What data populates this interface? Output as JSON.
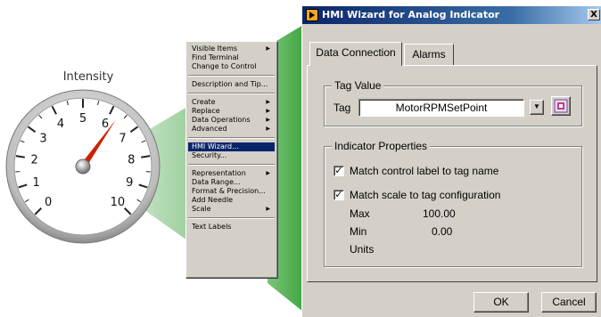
{
  "gauge": {
    "title": "Intensity",
    "ticks": [
      "0",
      "1",
      "2",
      "3",
      "4",
      "5",
      "6",
      "7",
      "8",
      "9",
      "10"
    ],
    "value": 6.3,
    "min": 0,
    "max": 10,
    "needle_color": "#cc2200"
  },
  "menu": {
    "items": [
      {
        "label": "Visible Items",
        "arrow": "▶"
      },
      {
        "label": "Find Terminal",
        "arrow": ""
      },
      {
        "label": "Change to Control",
        "arrow": ""
      },
      {
        "label": "Description and Tip...",
        "arrow": ""
      },
      {
        "label": "Create",
        "arrow": "▶"
      },
      {
        "label": "Replace",
        "arrow": "▶"
      },
      {
        "label": "Data Operations",
        "arrow": "▶"
      },
      {
        "label": "Advanced",
        "arrow": "▶"
      },
      {
        "label": "HMI Wizard...",
        "arrow": ""
      },
      {
        "label": "Security...",
        "arrow": ""
      },
      {
        "label": "Representation",
        "arrow": "▶"
      },
      {
        "label": "Data Range...",
        "arrow": ""
      },
      {
        "label": "Format & Precision...",
        "arrow": ""
      },
      {
        "label": "Add Needle",
        "arrow": ""
      },
      {
        "label": "Scale",
        "arrow": "▶"
      },
      {
        "label": "Text Labels",
        "arrow": ""
      }
    ],
    "selected": "HMI Wizard..."
  },
  "dialog": {
    "title": "HMI Wizard for Analog Indicator",
    "close": "X",
    "tabs": [
      "Data Connection",
      "Alarms"
    ],
    "tag_value_group": "Tag Value",
    "tag_label": "Tag",
    "tag_value": "MotorRPMSetPoint",
    "dropdown_arrow": "▼",
    "indicator_group": "Indicator Properties",
    "check1_label": "Match control label to tag name",
    "check1_mark": "✓",
    "check2_label": "Match scale to tag configuration",
    "check2_mark": "✓",
    "max_label": "Max",
    "max_value": "100.00",
    "min_label": "Min",
    "min_value": "0.00",
    "units_label": "Units",
    "ok": "OK",
    "cancel": "Cancel"
  },
  "colors": {
    "highlight": "#0a246a",
    "callout_green": "#5cb85c",
    "dialog_bg": "#d4d0c8"
  }
}
